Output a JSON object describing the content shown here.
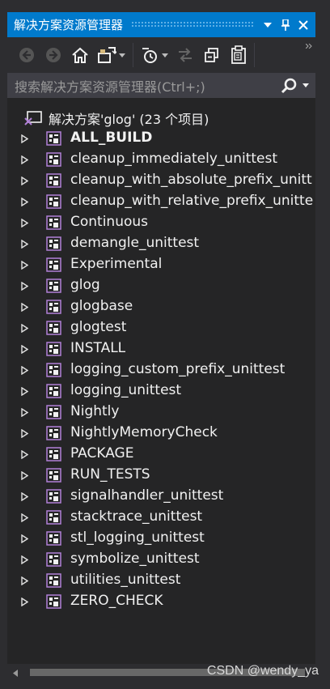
{
  "window": {
    "title": "解决方案资源管理器",
    "buttons": {
      "dropdown": "▾",
      "pin": "pin",
      "close": "close"
    }
  },
  "toolbar": {
    "icons": [
      "back-icon",
      "forward-icon",
      "home-icon",
      "switch-views-icon",
      "pending-changes-filter-icon",
      "sync-icon",
      "collapse-all-icon",
      "properties-icon"
    ]
  },
  "search": {
    "placeholder": "搜索解决方案资源管理器(Ctrl+;)"
  },
  "solution": {
    "label": "解决方案'glog' (23 个项目)"
  },
  "projects": [
    {
      "label": "ALL_BUILD",
      "bold": true
    },
    {
      "label": "cleanup_immediately_unittest",
      "bold": false
    },
    {
      "label": "cleanup_with_absolute_prefix_unitt",
      "bold": false
    },
    {
      "label": "cleanup_with_relative_prefix_unitte",
      "bold": false
    },
    {
      "label": "Continuous",
      "bold": false
    },
    {
      "label": "demangle_unittest",
      "bold": false
    },
    {
      "label": "Experimental",
      "bold": false
    },
    {
      "label": "glog",
      "bold": false
    },
    {
      "label": "glogbase",
      "bold": false
    },
    {
      "label": "glogtest",
      "bold": false
    },
    {
      "label": "INSTALL",
      "bold": false
    },
    {
      "label": "logging_custom_prefix_unittest",
      "bold": false
    },
    {
      "label": "logging_unittest",
      "bold": false
    },
    {
      "label": "Nightly",
      "bold": false
    },
    {
      "label": "NightlyMemoryCheck",
      "bold": false
    },
    {
      "label": "PACKAGE",
      "bold": false
    },
    {
      "label": "RUN_TESTS",
      "bold": false
    },
    {
      "label": "signalhandler_unittest",
      "bold": false
    },
    {
      "label": "stacktrace_unittest",
      "bold": false
    },
    {
      "label": "stl_logging_unittest",
      "bold": false
    },
    {
      "label": "symbolize_unittest",
      "bold": false
    },
    {
      "label": "utilities_unittest",
      "bold": false
    },
    {
      "label": "ZERO_CHECK",
      "bold": false
    }
  ],
  "watermark": "CSDN @wendy_ya",
  "colors": {
    "accent": "#007acc",
    "background": "#252526",
    "chrome": "#2d2d30",
    "text": "#f1f1f1",
    "project_icon_border": "#b180d7"
  }
}
